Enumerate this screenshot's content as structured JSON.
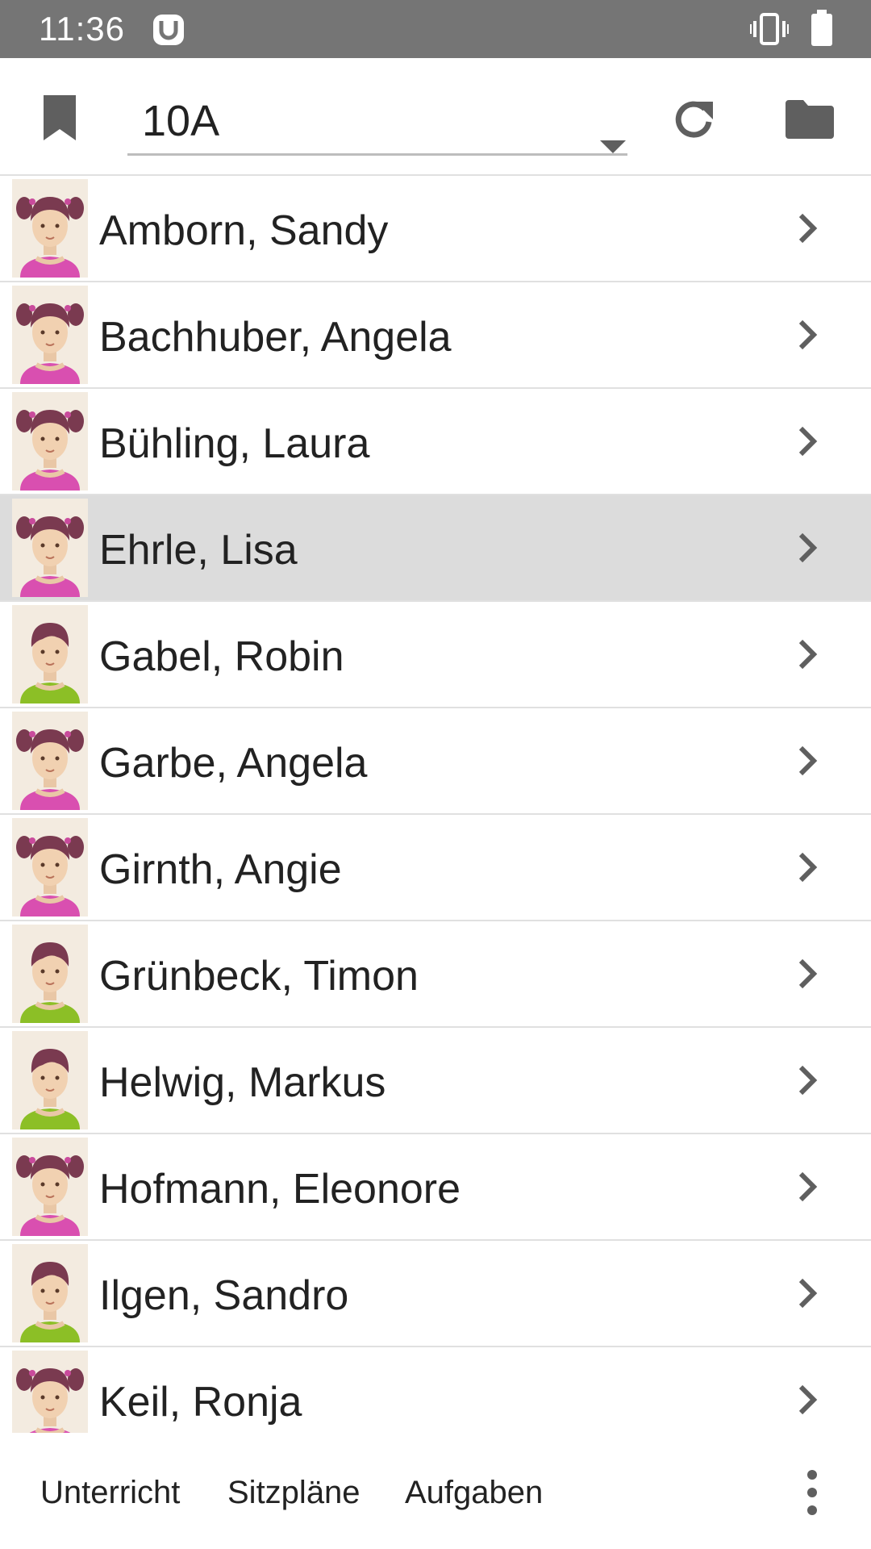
{
  "status_bar": {
    "time": "11:36",
    "icons": [
      "app-notification-icon",
      "vibrate-icon",
      "battery-icon"
    ]
  },
  "toolbar": {
    "class_select": {
      "value": "10A"
    },
    "icons": [
      "bookmark-icon",
      "dropdown-arrow-icon",
      "refresh-icon",
      "folder-icon"
    ]
  },
  "students": [
    {
      "name": "Amborn, Sandy",
      "avatar": "girl"
    },
    {
      "name": "Bachhuber, Angela",
      "avatar": "girl"
    },
    {
      "name": "Bühling, Laura",
      "avatar": "girl"
    },
    {
      "name": "Ehrle, Lisa",
      "avatar": "girl",
      "selected": true
    },
    {
      "name": "Gabel, Robin",
      "avatar": "boy"
    },
    {
      "name": "Garbe, Angela",
      "avatar": "girl"
    },
    {
      "name": "Girnth, Angie",
      "avatar": "girl"
    },
    {
      "name": "Grünbeck, Timon",
      "avatar": "boy"
    },
    {
      "name": "Helwig, Markus",
      "avatar": "boy"
    },
    {
      "name": "Hofmann, Eleonore",
      "avatar": "girl"
    },
    {
      "name": "Ilgen, Sandro",
      "avatar": "boy"
    },
    {
      "name": "Keil, Ronja",
      "avatar": "girl"
    }
  ],
  "bottom_tabs": {
    "unterricht": "Unterricht",
    "sitzplaene": "Sitzpläne",
    "aufgaben": "Aufgaben"
  },
  "colors": {
    "status_bar": "#757575",
    "selected_row": "#dcdcdc",
    "icon_gray": "#5f5f5f",
    "girl_shirt": "#d94fb0",
    "boy_shirt": "#8cbf26",
    "hair": "#7a3a50"
  }
}
